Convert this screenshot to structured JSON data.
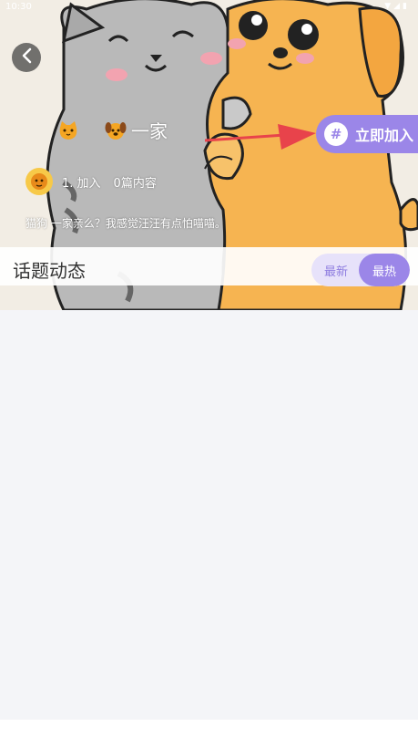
{
  "status_bar": {
    "time": "10:30"
  },
  "topic": {
    "title_suffix": "一家",
    "join_label": "立即加入",
    "join_icon": "#",
    "stats_joined": "1.  加入",
    "stats_posts": "0篇内容",
    "description": "猫狗  一家亲么？我感觉汪汪有点怕喵喵。"
  },
  "section": {
    "title": "话题动态",
    "tab_new": "最新",
    "tab_hot": "最热"
  },
  "colors": {
    "accent": "#9b86e8",
    "tab_bg": "#e7e2fa",
    "content_bg": "#f4f5f8"
  },
  "icons": [
    "back-arrow-icon",
    "cat-emoji-icon",
    "dog-emoji-icon",
    "hashtag-icon",
    "avatar-icon",
    "wifi-icon",
    "signal-icon",
    "battery-icon"
  ]
}
